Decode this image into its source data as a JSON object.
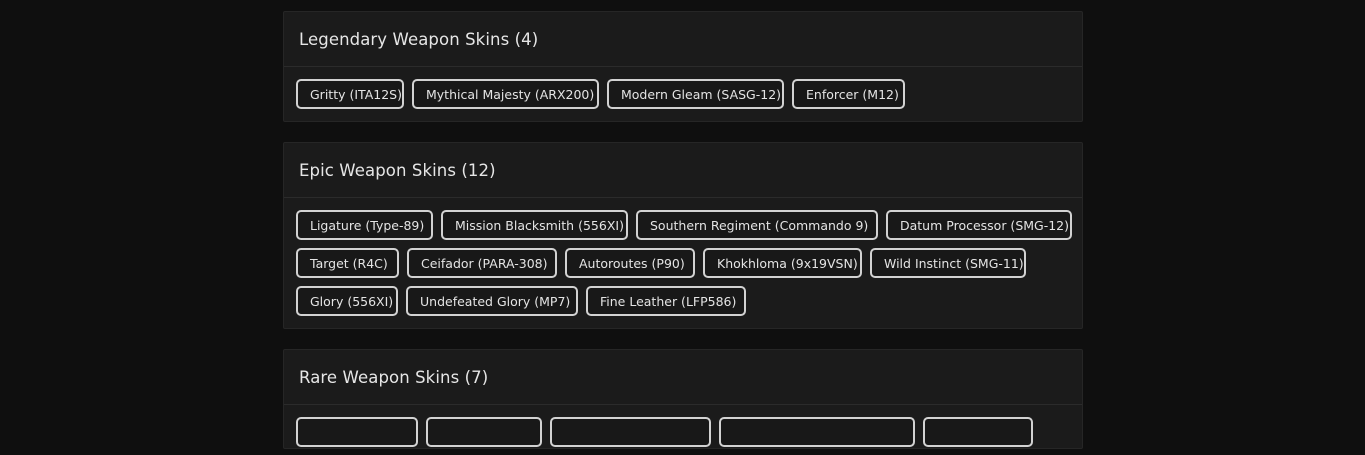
{
  "sections": {
    "legendary": {
      "title": "Legendary Weapon Skins (4)",
      "skins": [
        "Gritty (ITA12S)",
        "Mythical Majesty (ARX200)",
        "Modern Gleam (SASG-12)",
        "Enforcer (M12)"
      ]
    },
    "epic": {
      "title": "Epic Weapon Skins (12)",
      "skins": [
        "Ligature (Type-89)",
        "Mission Blacksmith (556XI)",
        "Southern Regiment (Commando 9)",
        "Datum Processor (SMG-12)",
        "Target (R4C)",
        "Ceifador (PARA-308)",
        "Autoroutes (P90)",
        "Khokhloma (9x19VSN)",
        "Wild Instinct (SMG-11)",
        "Glory (556XI)",
        "Undefeated Glory (MP7)",
        "Fine Leather (LFP586)"
      ]
    },
    "rare": {
      "title": "Rare Weapon Skins (7)",
      "skins": []
    }
  }
}
